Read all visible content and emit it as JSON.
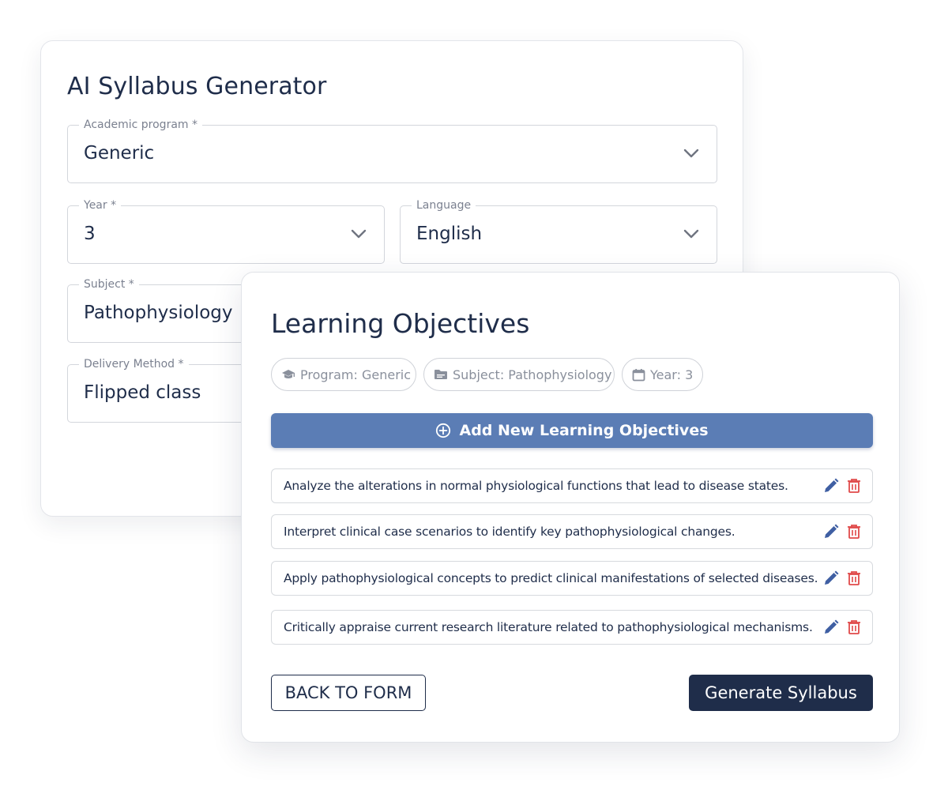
{
  "form": {
    "title": "AI Syllabus Generator",
    "fields": {
      "academic_program": {
        "label": "Academic program *",
        "value": "Generic"
      },
      "year": {
        "label": "Year *",
        "value": "3"
      },
      "language": {
        "label": "Language",
        "value": "English"
      },
      "subject": {
        "label": "Subject *",
        "value": "Pathophysiology"
      },
      "delivery_method": {
        "label": "Delivery Method *",
        "value": "Flipped class"
      }
    }
  },
  "learning_objectives": {
    "title": "Learning Objectives",
    "chips": {
      "program": {
        "label": "Program: Generic",
        "icon": "graduation-cap-icon"
      },
      "subject": {
        "label": "Subject: Pathophysiology",
        "icon": "folder-icon"
      },
      "year": {
        "label": "Year: 3",
        "icon": "calendar-icon"
      }
    },
    "add_button_label": "Add New Learning Objectives",
    "items": [
      {
        "text": "Analyze the alterations in normal physiological functions that lead to disease states."
      },
      {
        "text": "Interpret clinical case scenarios to identify key pathophysiological changes."
      },
      {
        "text": "Apply pathophysiological concepts to predict clinical manifestations of selected diseases."
      },
      {
        "text": "Critically appraise current research literature related to pathophysiological mechanisms."
      }
    ],
    "back_button_label": "BACK TO FORM",
    "generate_button_label": "Generate Syllabus"
  },
  "colors": {
    "primary_dark": "#1f2d4a",
    "accent_blue": "#5b7db5",
    "delete_red": "#e04a4a",
    "edit_blue": "#3f5fa3"
  }
}
